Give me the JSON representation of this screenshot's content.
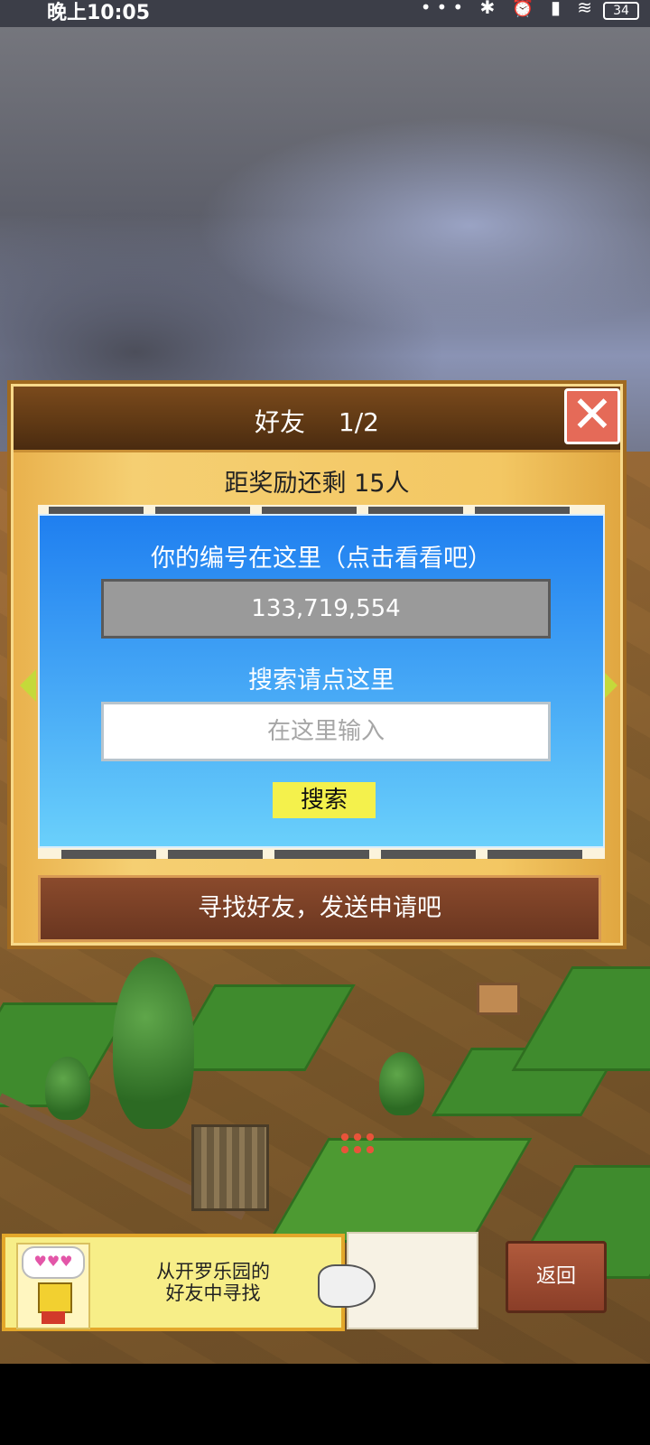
{
  "status_bar": {
    "time": "晚上10:05",
    "icons": [
      "more-icon",
      "bluetooth-icon",
      "alarm-icon",
      "signal-icon",
      "wifi-icon"
    ],
    "battery": "34"
  },
  "dialog": {
    "title": "好友",
    "page": "1/2",
    "reward_text": "距奖励还剩 15人",
    "id_label": "你的编号在这里（点击看看吧）",
    "id_value": "133,719,554",
    "search_label": "搜索请点这里",
    "search_placeholder": "在这里输入",
    "search_button": "搜索",
    "find_friends": "寻找好友，发送申请吧"
  },
  "hint": {
    "line1": "从开罗乐园的",
    "line2": "好友中寻找",
    "bubble": "♥♥♥"
  },
  "back_button": "返回",
  "colors": {
    "accent_blue": "#1f7ff0",
    "search_button": "#f4f14c",
    "close_button": "#e56a58"
  }
}
